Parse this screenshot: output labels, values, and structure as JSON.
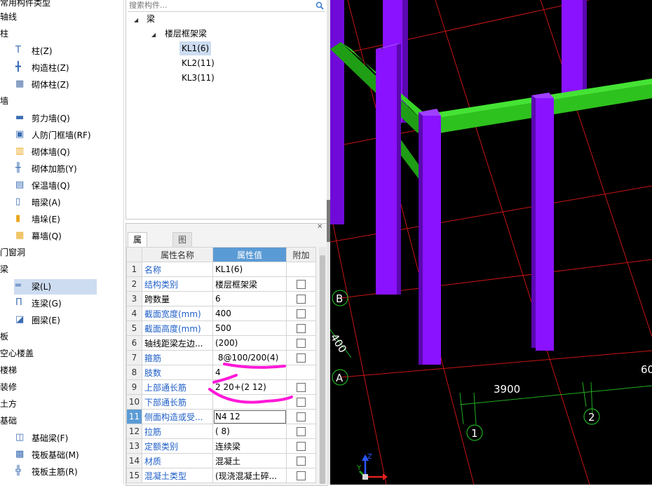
{
  "nav": {
    "groups": [
      {
        "label": "常用构件类型",
        "items": []
      },
      {
        "label": "轴线",
        "items": []
      },
      {
        "label": "柱",
        "items": [
          {
            "label": "柱(Z)",
            "icon": "column-icon"
          },
          {
            "label": "构造柱(Z)",
            "icon": "constructional-column-icon"
          },
          {
            "label": "砌体柱(Z)",
            "icon": "masonry-column-icon"
          }
        ]
      },
      {
        "label": "墙",
        "items": [
          {
            "label": "剪力墙(Q)",
            "icon": "shear-wall-icon"
          },
          {
            "label": "人防门框墙(RF)",
            "icon": "civil-defense-door-wall-icon"
          },
          {
            "label": "砌体墙(Q)",
            "icon": "masonry-wall-icon"
          },
          {
            "label": "砌体加筋(Y)",
            "icon": "masonry-reinforcement-icon"
          },
          {
            "label": "保温墙(Q)",
            "icon": "insulation-wall-icon"
          },
          {
            "label": "暗梁(A)",
            "icon": "hidden-beam-icon"
          },
          {
            "label": "墙垛(E)",
            "icon": "wall-pier-icon"
          },
          {
            "label": "幕墙(Q)",
            "icon": "curtain-wall-icon"
          }
        ]
      },
      {
        "label": "门窗洞",
        "items": []
      },
      {
        "label": "梁",
        "items": [
          {
            "label": "梁(L)",
            "icon": "beam-icon",
            "selected": true
          },
          {
            "label": "连梁(G)",
            "icon": "coupling-beam-icon"
          },
          {
            "label": "圈梁(E)",
            "icon": "ring-beam-icon"
          }
        ]
      },
      {
        "label": "板",
        "items": []
      },
      {
        "label": "空心楼盖",
        "items": []
      },
      {
        "label": "楼梯",
        "items": []
      },
      {
        "label": "装修",
        "items": []
      },
      {
        "label": "土方",
        "items": []
      },
      {
        "label": "基础",
        "items": [
          {
            "label": "基础梁(F)",
            "icon": "foundation-beam-icon"
          },
          {
            "label": "筏板基础(M)",
            "icon": "raft-foundation-icon"
          },
          {
            "label": "筏板主筋(R)",
            "icon": "raft-main-rebar-icon"
          }
        ]
      }
    ]
  },
  "tree": {
    "search_placeholder": "搜索构件...",
    "root": "梁",
    "child": "楼层框架梁",
    "leaves": [
      "KL1(6)",
      "KL2(11)",
      "KL3(11)"
    ]
  },
  "props": {
    "tabs": [
      "属性列表",
      "图层管理"
    ],
    "headers": [
      "属性名称",
      "属性值",
      "附加"
    ],
    "rows": [
      {
        "n": "1",
        "name": "名称",
        "value": "KL1(6)",
        "link": true,
        "check": false
      },
      {
        "n": "2",
        "name": "结构类别",
        "value": "楼层框架梁",
        "link": true,
        "check": true
      },
      {
        "n": "3",
        "name": "跨数量",
        "value": "6",
        "link": false,
        "check": true
      },
      {
        "n": "4",
        "name": "截面宽度(mm)",
        "value": "400",
        "link": true,
        "check": true
      },
      {
        "n": "5",
        "name": "截面高度(mm)",
        "value": "500",
        "link": true,
        "check": true
      },
      {
        "n": "6",
        "name": "轴线距梁左边...",
        "value": "(200)",
        "link": false,
        "check": true
      },
      {
        "n": "7",
        "name": "箍筋",
        "value": " 8@100/200(4)",
        "link": true,
        "check": true
      },
      {
        "n": "8",
        "name": "肢数",
        "value": "4",
        "link": true,
        "check": false
      },
      {
        "n": "9",
        "name": "上部通长筋",
        "value": "2 20+(2 12)",
        "link": true,
        "check": true
      },
      {
        "n": "10",
        "name": "下部通长筋",
        "value": "",
        "link": true,
        "check": true
      },
      {
        "n": "11",
        "name": "侧面构造或受...",
        "value": "N4 12",
        "link": true,
        "check": true,
        "current": true
      },
      {
        "n": "12",
        "name": "拉筋",
        "value": "( 8)",
        "link": true,
        "check": true
      },
      {
        "n": "13",
        "name": "定额类别",
        "value": "连续梁",
        "link": true,
        "check": true
      },
      {
        "n": "14",
        "name": "材质",
        "value": "混凝土",
        "link": true,
        "check": true
      },
      {
        "n": "15",
        "name": "混凝土类型",
        "value": "(现浇混凝土碎...",
        "link": true,
        "check": true
      }
    ]
  },
  "viewport": {
    "axis_labels": [
      "B",
      "A",
      "1",
      "2"
    ],
    "dimension_text": "3900",
    "partial_dimension_left": "400",
    "partial_dimension_right": "60"
  },
  "colors": {
    "selection": "#cddcf1",
    "header_accent": "#5b9bd5",
    "link_text": "#1f5fc7",
    "column_purple": "#8a12ff",
    "beam_green": "#2ec21e",
    "grid_red": "#c81414",
    "axis_green": "#1fae1f",
    "annotation_magenta": "#ff19d8"
  }
}
